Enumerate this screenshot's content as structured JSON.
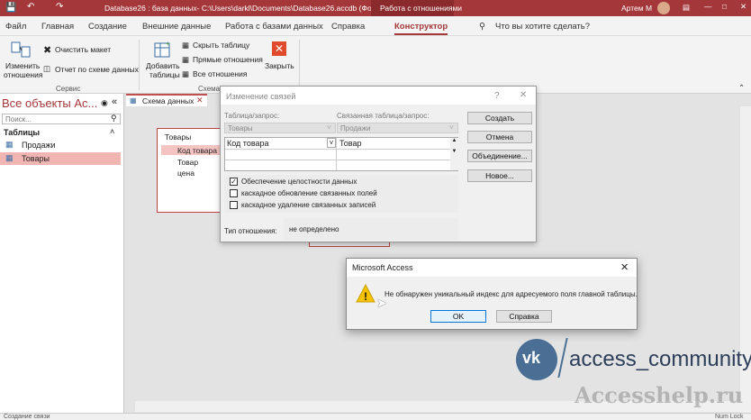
{
  "window": {
    "title": "Database26 : база данных- C:\\Users\\darkl\\Documents\\Database26.accdb (Форм...",
    "context_tab": "Работа с отношениями",
    "user": "Артем М"
  },
  "tabs": [
    "Файл",
    "Главная",
    "Создание",
    "Внешние данные",
    "Работа с базами данных",
    "Справка",
    "Конструктор"
  ],
  "search": "Что вы хотите сделать?",
  "ribbon": {
    "change_relations_line1": "Изменить",
    "change_relations_line2": "отношения",
    "clear_layout": "Очистить макет",
    "report": "Отчет по схеме данных",
    "add_table_line1": "Добавить",
    "add_table_line2": "таблицы",
    "hide_table": "Скрыть таблицу",
    "direct_relations": "Прямые отношения",
    "all_relations": "Все отношения",
    "close": "Закрыть",
    "group_service": "Сервис",
    "group_schema": "Схема д..."
  },
  "nav": {
    "title": "Все объекты Ac...",
    "search_placeholder": "Поиск...",
    "section": "Таблицы",
    "items": [
      "Продажи",
      "Товары"
    ]
  },
  "doc_tab": "Схема данных",
  "table_window": {
    "title": "Товары",
    "fields": [
      "Код товара",
      "Товар",
      "цена"
    ]
  },
  "edit_dialog": {
    "title": "Изменение связей",
    "table_label": "Таблица/запрос:",
    "related_label": "Связанная таблица/запрос:",
    "table_value": "Товары",
    "related_value": "Продажи",
    "field_left": "Код товара",
    "field_right": "Товар",
    "integrity": "Обеспечение целостности данных",
    "cascade_update": "каскадное обновление связанных полей",
    "cascade_delete": "каскадное удаление связанных записей",
    "relation_type_label": "Тип отношения:",
    "relation_type_value": "не определено",
    "btn_create": "Создать",
    "btn_cancel": "Отмена",
    "btn_join": "Объединение...",
    "btn_new": "Новое...",
    "help": "?"
  },
  "msgbox": {
    "title": "Microsoft Access",
    "text": "Не обнаружен уникальный индекс для адресуемого поля главной таблицы.",
    "ok": "OK",
    "help": "Справка"
  },
  "watermark": {
    "community": "access_community",
    "site": "Accesshelp.ru"
  },
  "status": {
    "left": "Создание связи",
    "right": "Num Lock"
  },
  "colors": {
    "accent": "#a4373a",
    "vk": "#4a6e94"
  }
}
